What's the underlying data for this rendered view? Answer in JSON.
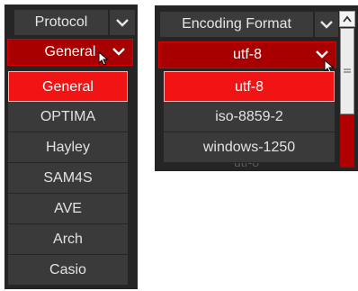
{
  "protocol_panel": {
    "header_label": "Protocol",
    "selected_value": "General",
    "options": [
      "General",
      "OPTIMA",
      "Hayley",
      "SAM4S",
      "AVE",
      "Arch",
      "Casio"
    ],
    "highlighted_option": "General"
  },
  "encoding_panel": {
    "header_label": "Encoding Format",
    "selected_value": "utf-8",
    "options": [
      "utf-8",
      "iso-8859-2",
      "windows-1250"
    ],
    "highlighted_option": "utf-8",
    "obscured_text": "utf-8"
  },
  "colors": {
    "panel_bg": "#252525",
    "header_bg": "#3b3b3b",
    "select_bg": "#a80000",
    "highlight_bg": "#f21414",
    "option_bg": "#3a3a3a",
    "scrollbar_track": "#b10000"
  },
  "icons": {
    "header_chevron": "chevron-down-icon",
    "select_chevron": "chevron-down-icon",
    "cursor": "mouse-pointer-icon",
    "scroll_up": "chevron-up-icon",
    "scroll_thumb_grip": "grip-lines-icon"
  }
}
